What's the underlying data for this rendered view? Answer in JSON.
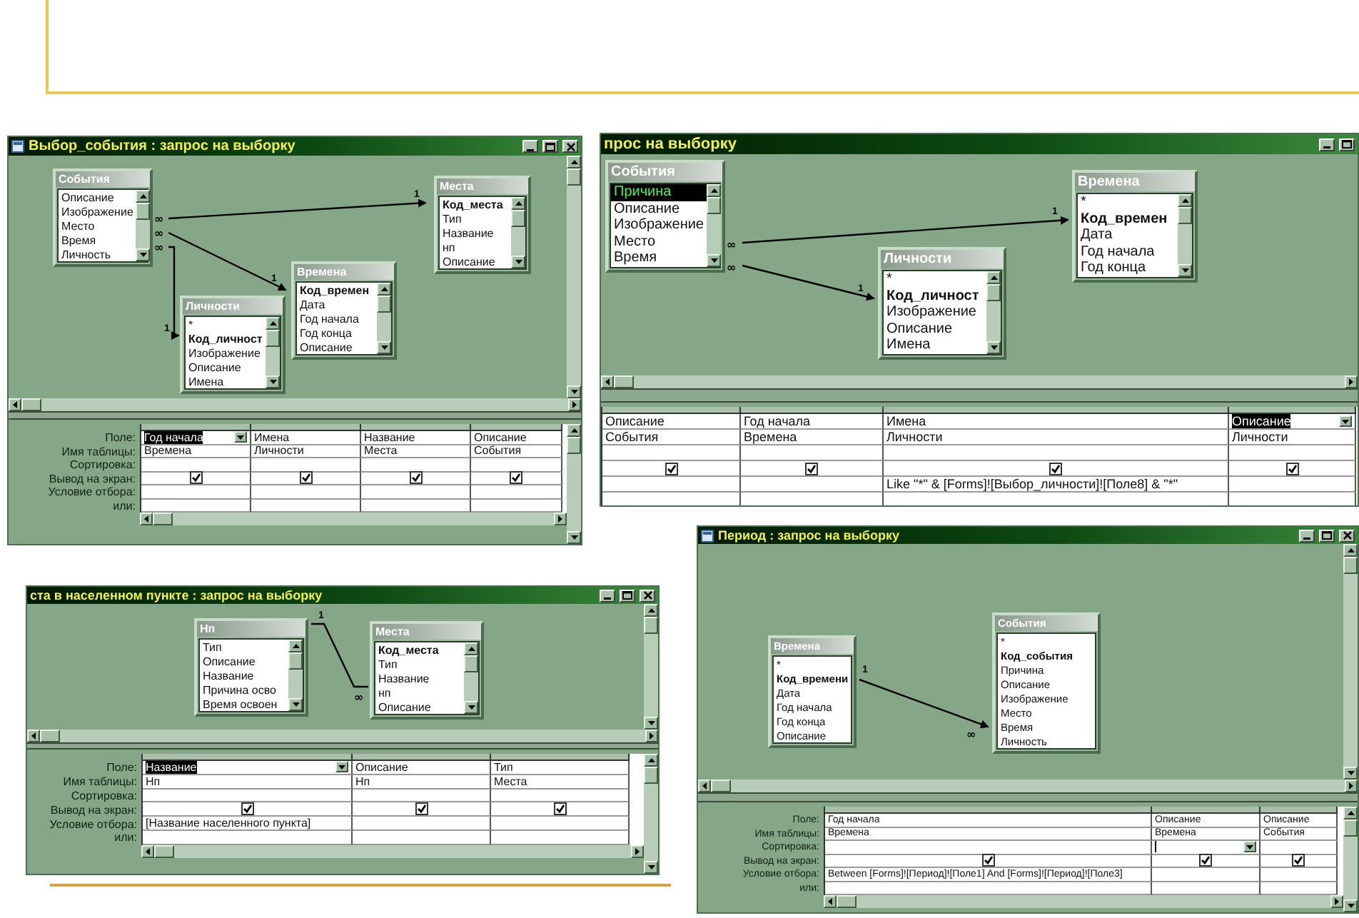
{
  "windows": [
    {
      "title": "Выбор_события : запрос на выборку",
      "tables": [
        {
          "name": "События",
          "fields": [
            {
              "name": "Описание",
              "key": false,
              "selected": false
            },
            {
              "name": "Изображение",
              "key": false,
              "selected": false
            },
            {
              "name": "Место",
              "key": false,
              "selected": false
            },
            {
              "name": "Время",
              "key": false,
              "selected": false
            },
            {
              "name": "Личность",
              "key": false,
              "selected": false
            }
          ]
        },
        {
          "name": "Места",
          "fields": [
            {
              "name": "Код_места",
              "key": true,
              "selected": false
            },
            {
              "name": "Тип",
              "key": false,
              "selected": false
            },
            {
              "name": "Название",
              "key": false,
              "selected": false
            },
            {
              "name": "нп",
              "key": false,
              "selected": false
            },
            {
              "name": "Описание",
              "key": false,
              "selected": false
            }
          ]
        },
        {
          "name": "Времена",
          "fields": [
            {
              "name": "Код_времен",
              "key": true,
              "selected": false
            },
            {
              "name": "Дата",
              "key": false,
              "selected": false
            },
            {
              "name": "Год начала",
              "key": false,
              "selected": false
            },
            {
              "name": "Год конца",
              "key": false,
              "selected": false
            },
            {
              "name": "Описание",
              "key": false,
              "selected": false
            }
          ]
        },
        {
          "name": "Личности",
          "fields": [
            {
              "name": "*",
              "key": false,
              "selected": false
            },
            {
              "name": "Код_личност",
              "key": true,
              "selected": false
            },
            {
              "name": "Изображение",
              "key": false,
              "selected": false
            },
            {
              "name": "Описание",
              "key": false,
              "selected": false
            },
            {
              "name": "Имена",
              "key": false,
              "selected": false
            }
          ]
        }
      ],
      "relations": [
        {
          "one": "1",
          "many": "∞"
        },
        {
          "one": "1",
          "many": "∞"
        },
        {
          "one": "1",
          "many": "∞"
        }
      ],
      "grid": {
        "row_labels": [
          "Поле:",
          "Имя таблицы:",
          "Сортировка:",
          "Вывод на экран:",
          "Условие отбора:",
          "или:"
        ],
        "columns": [
          {
            "field": "Год начала",
            "table": "Времена",
            "show": true,
            "selected": true
          },
          {
            "field": "Имена",
            "table": "Личности",
            "show": true,
            "selected": false
          },
          {
            "field": "Название",
            "table": "Места",
            "show": true,
            "selected": false
          },
          {
            "field": "Описание",
            "table": "События",
            "show": true,
            "selected": false
          }
        ]
      }
    },
    {
      "title": "прос на выборку",
      "tables": [
        {
          "name": "События",
          "fields": [
            {
              "name": "Причина",
              "key": false,
              "selected": true
            },
            {
              "name": "Описание",
              "key": false,
              "selected": false
            },
            {
              "name": "Изображение",
              "key": false,
              "selected": false
            },
            {
              "name": "Место",
              "key": false,
              "selected": false
            },
            {
              "name": "Время",
              "key": false,
              "selected": false
            }
          ]
        },
        {
          "name": "Времена",
          "fields": [
            {
              "name": "*",
              "key": false,
              "selected": false
            },
            {
              "name": "Код_времен",
              "key": true,
              "selected": false
            },
            {
              "name": "Дата",
              "key": false,
              "selected": false
            },
            {
              "name": "Год начала",
              "key": false,
              "selected": false
            },
            {
              "name": "Год конца",
              "key": false,
              "selected": false
            }
          ]
        },
        {
          "name": "Личности",
          "fields": [
            {
              "name": "*",
              "key": false,
              "selected": false
            },
            {
              "name": "Код_личност",
              "key": true,
              "selected": false
            },
            {
              "name": "Изображение",
              "key": false,
              "selected": false
            },
            {
              "name": "Описание",
              "key": false,
              "selected": false
            },
            {
              "name": "Имена",
              "key": false,
              "selected": false
            }
          ]
        }
      ],
      "relations": [
        {
          "one": "1",
          "many": "∞"
        },
        {
          "one": "1",
          "many": "∞"
        }
      ],
      "grid": {
        "columns": [
          {
            "field": "Описание",
            "table": "События",
            "show": true,
            "selected": false
          },
          {
            "field": "Год начала",
            "table": "Времена",
            "show": true,
            "selected": false
          },
          {
            "field": "Имена",
            "table": "Личности",
            "show": true,
            "criteria": "Like \"*\" & [Forms]![Выбор_личности]![Поле8] & \"*\"",
            "selected": false
          },
          {
            "field": "Описание",
            "table": "Личности",
            "show": true,
            "selected": true
          }
        ]
      }
    },
    {
      "title": "ста в населенном пункте : запрос на выборку",
      "tables": [
        {
          "name": "Нп",
          "fields": [
            {
              "name": "Тип",
              "key": false,
              "selected": false
            },
            {
              "name": "Описание",
              "key": false,
              "selected": false
            },
            {
              "name": "Название",
              "key": false,
              "selected": false
            },
            {
              "name": "Причина осво",
              "key": false,
              "selected": false
            },
            {
              "name": "Время освоен",
              "key": false,
              "selected": false
            }
          ]
        },
        {
          "name": "Места",
          "fields": [
            {
              "name": "Код_места",
              "key": true,
              "selected": false
            },
            {
              "name": "Тип",
              "key": false,
              "selected": false
            },
            {
              "name": "Название",
              "key": false,
              "selected": false
            },
            {
              "name": "нп",
              "key": false,
              "selected": false
            },
            {
              "name": "Описание",
              "key": false,
              "selected": false
            }
          ]
        }
      ],
      "relations": [
        {
          "one": "1",
          "many": "∞"
        }
      ],
      "grid": {
        "row_labels": [
          "Поле:",
          "Имя таблицы:",
          "Сортировка:",
          "Вывод на экран:",
          "Условие отбора:",
          "или:"
        ],
        "columns": [
          {
            "field": "Название",
            "table": "Нп",
            "show": true,
            "criteria": "[Название населенного пункта]",
            "selected": true
          },
          {
            "field": "Описание",
            "table": "Нп",
            "show": true,
            "selected": false
          },
          {
            "field": "Тип",
            "table": "Места",
            "show": true,
            "selected": false
          }
        ]
      }
    },
    {
      "title": "Период : запрос на выборку",
      "tables": [
        {
          "name": "Времена",
          "fields": [
            {
              "name": "*",
              "key": false,
              "selected": false
            },
            {
              "name": "Код_времени",
              "key": true,
              "selected": false
            },
            {
              "name": "Дата",
              "key": false,
              "selected": false
            },
            {
              "name": "Год начала",
              "key": false,
              "selected": false
            },
            {
              "name": "Год конца",
              "key": false,
              "selected": false
            },
            {
              "name": "Описание",
              "key": false,
              "selected": false
            }
          ]
        },
        {
          "name": "События",
          "fields": [
            {
              "name": "*",
              "key": false,
              "selected": false
            },
            {
              "name": "Код_события",
              "key": true,
              "selected": false
            },
            {
              "name": "Причина",
              "key": false,
              "selected": false
            },
            {
              "name": "Описание",
              "key": false,
              "selected": false
            },
            {
              "name": "Изображение",
              "key": false,
              "selected": false
            },
            {
              "name": "Место",
              "key": false,
              "selected": false
            },
            {
              "name": "Время",
              "key": false,
              "selected": false
            },
            {
              "name": "Личность",
              "key": false,
              "selected": false
            }
          ]
        }
      ],
      "relations": [
        {
          "one": "1",
          "many": "∞"
        }
      ],
      "grid": {
        "row_labels": [
          "Поле:",
          "Имя таблицы:",
          "Сортировка:",
          "Вывод на экран:",
          "Условие отбора:",
          "или:"
        ],
        "columns": [
          {
            "field": "Год начала",
            "table": "Времена",
            "show": true,
            "criteria": "Between [Forms]![Период]![Поле1] And [Forms]![Период]![Поле3]",
            "selected": false
          },
          {
            "field": "Описание",
            "table": "Времена",
            "show": true,
            "selected": false,
            "sort_dropdown": true
          },
          {
            "field": "Описание",
            "table": "События",
            "show": true,
            "selected": false
          }
        ]
      }
    }
  ]
}
